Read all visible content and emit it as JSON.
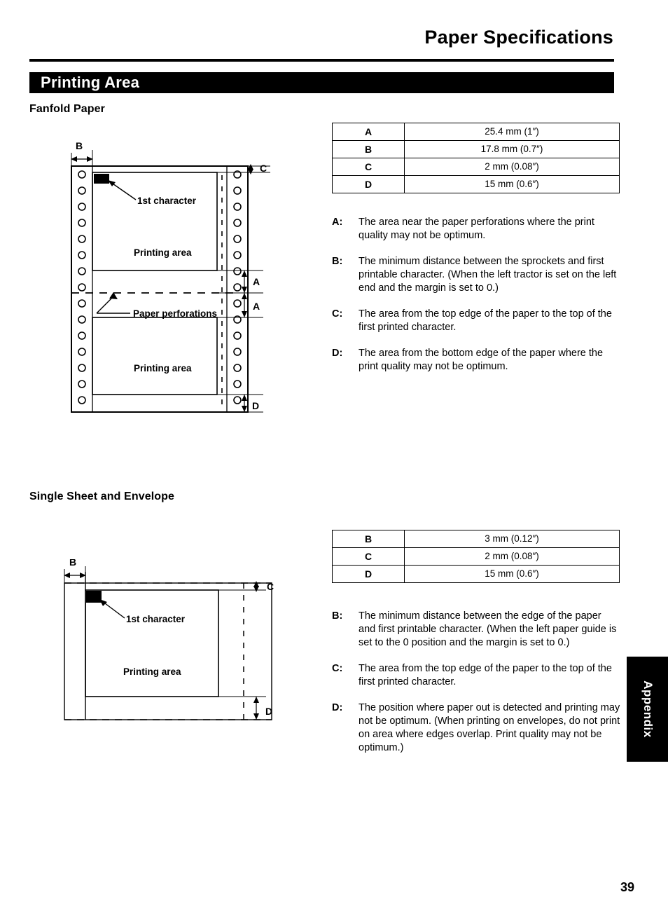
{
  "header": {
    "title": "Paper Specifications"
  },
  "section": {
    "banner_label": "Printing Area"
  },
  "fanfold": {
    "heading": "Fanfold Paper",
    "table": {
      "rows": [
        {
          "key": "A",
          "value": "25.4 mm (1″)"
        },
        {
          "key": "B",
          "value": "17.8 mm (0.7″)"
        },
        {
          "key": "C",
          "value": "2 mm (0.08″)"
        },
        {
          "key": "D",
          "value": "15 mm (0.6″)"
        }
      ]
    },
    "descriptions": [
      {
        "key": "A:",
        "text": "The area near the paper perforations where the print quality may not be optimum."
      },
      {
        "key": "B:",
        "text": "The minimum distance between the sprockets and first printable character. (When the left tractor is set on the left end and the margin is set to 0.)"
      },
      {
        "key": "C:",
        "text": "The area from the top edge of the paper to the top of the first printed character."
      },
      {
        "key": "D:",
        "text": "The area from the bottom edge of the paper where the print quality may not be optimum."
      }
    ],
    "diagram": {
      "label_first_character": "1st character",
      "label_printing_area_top": "Printing area",
      "label_paper_perforations": "Paper perforations",
      "label_printing_area_bottom": "Printing area",
      "dim_b": "B",
      "dim_c": "C",
      "dim_a_upper": "A",
      "dim_a_lower": "A",
      "dim_d": "D"
    }
  },
  "single_sheet": {
    "heading": "Single Sheet and Envelope",
    "table": {
      "rows": [
        {
          "key": "B",
          "value": "3 mm (0.12″)"
        },
        {
          "key": "C",
          "value": "2 mm (0.08″)"
        },
        {
          "key": "D",
          "value": "15 mm (0.6″)"
        }
      ]
    },
    "descriptions": [
      {
        "key": "B:",
        "text": "The minimum distance between the edge of the paper and first printable character. (When the left paper guide is set to the 0 position and the margin is set to 0.)"
      },
      {
        "key": "C:",
        "text": "The area from the top edge of the paper to the top of the first printed character."
      },
      {
        "key": "D:",
        "text": "The position where paper out is detected and printing may not be optimum. (When printing on envelopes, do not print on area where edges overlap. Print quality may not be optimum.)"
      }
    ],
    "diagram": {
      "label_first_character": "1st character",
      "label_printing_area": "Printing area",
      "dim_b": "B",
      "dim_c": "C",
      "dim_d": "D"
    }
  },
  "appendix_tab": {
    "label": "Appendix"
  },
  "footer": {
    "page_number": "39"
  },
  "colors": {
    "ink": "#000000",
    "paper": "#ffffff"
  }
}
